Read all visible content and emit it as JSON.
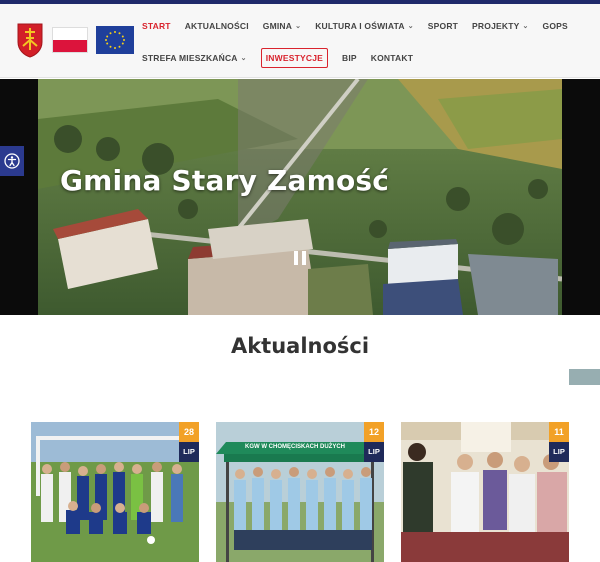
{
  "nav": {
    "row1": [
      {
        "label": "START",
        "active": true,
        "dropdown": false
      },
      {
        "label": "AKTUALNOŚCI",
        "active": false,
        "dropdown": false
      },
      {
        "label": "GMINA",
        "active": false,
        "dropdown": true
      },
      {
        "label": "KULTURA I OŚWIATA",
        "active": false,
        "dropdown": true
      },
      {
        "label": "SPORT",
        "active": false,
        "dropdown": false
      },
      {
        "label": "PROJEKTY",
        "active": false,
        "dropdown": true
      },
      {
        "label": "GOPS",
        "active": false,
        "dropdown": false
      }
    ],
    "row2": [
      {
        "label": "STREFA MIESZKAŃCA",
        "active": false,
        "dropdown": true
      },
      {
        "label": "INWESTYCJE",
        "active": false,
        "dropdown": false,
        "boxed": true
      },
      {
        "label": "BIP",
        "active": false,
        "dropdown": false
      },
      {
        "label": "KONTAKT",
        "active": false,
        "dropdown": false
      }
    ],
    "chevron": "⌄"
  },
  "hero": {
    "title": "Gmina Stary Zamość"
  },
  "section": {
    "title": "Aktualności"
  },
  "cards": [
    {
      "day": "28",
      "month": "LIP",
      "banner": ""
    },
    {
      "day": "12",
      "month": "LIP",
      "banner": "KGW W CHOMĘCISKACH DUŻYCH"
    },
    {
      "day": "11",
      "month": "LIP",
      "banner": ""
    }
  ],
  "colors": {
    "accent": "#d9232d",
    "navy": "#1f2a5a",
    "date_orange": "#f2a127",
    "a11y": "#2b3a8f"
  },
  "icons": {
    "accessibility": "accessibility-icon",
    "pause": "pause-icon",
    "crest": "coat-of-arms-icon"
  }
}
